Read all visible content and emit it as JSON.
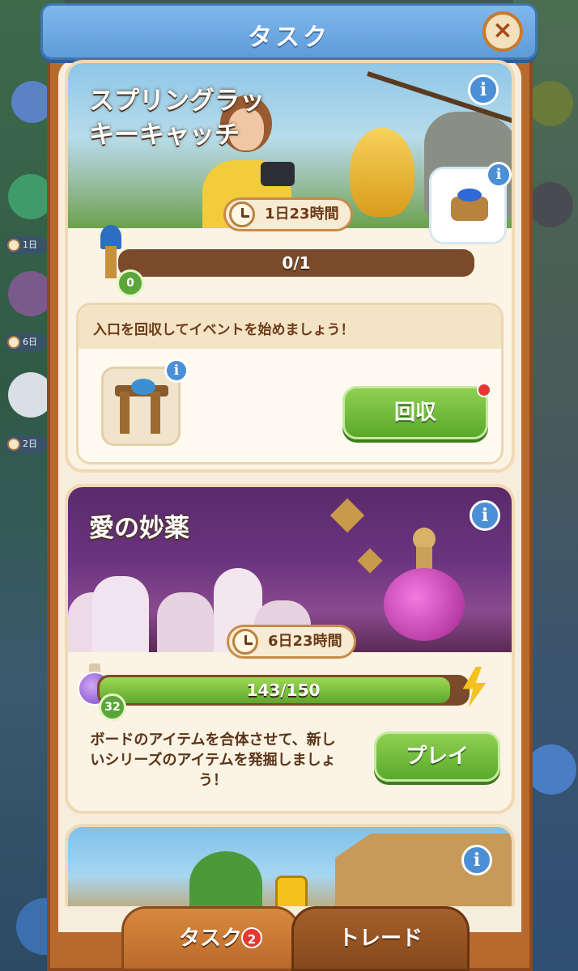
{
  "header": {
    "title": "タスク",
    "close_label": "×"
  },
  "cards": [
    {
      "title_line1": "スプリングラッ",
      "title_line2": "キーキャッチ",
      "info_label": "i",
      "timer": "1日23時間",
      "progress_text": "0/1",
      "progress": 0,
      "level_badge": "0",
      "instruction": "入口を回収してイベントを始めましょう！",
      "item_info_label": "i",
      "button_label": "回収"
    },
    {
      "title": "愛の妙薬",
      "info_label": "i",
      "timer": "6日23時間",
      "progress_text": "143/150",
      "progress": 0.953,
      "level_badge": "32",
      "description_line1": "ボードのアイテムを合体させて、新し",
      "description_line2": "いシリーズのアイテムを発掘しましょ",
      "description_line3": "う！",
      "button_label": "プレイ"
    },
    {
      "info_label": "i"
    }
  ],
  "side_badges": [
    "1日",
    "6日",
    "2日"
  ],
  "tabs": [
    {
      "label": "タスク",
      "badge": "2"
    },
    {
      "label": "トレード"
    }
  ],
  "colors": {
    "panel_frame": "#b86a2e",
    "header_blue": "#5f9bd9",
    "button_green": "#5aa92c",
    "info_blue": "#4b8fd6"
  }
}
